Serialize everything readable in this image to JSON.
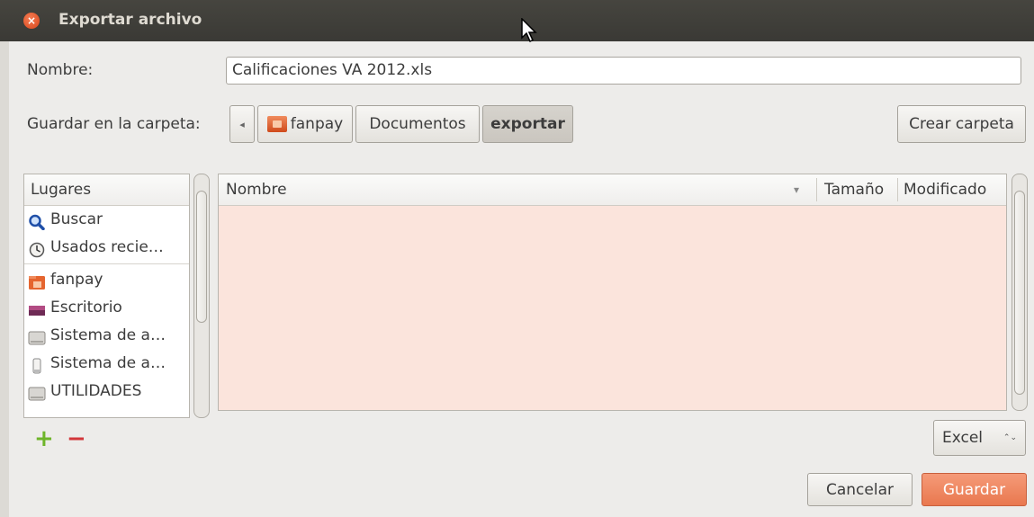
{
  "window": {
    "title": "Exportar archivo",
    "close_glyph": "×"
  },
  "name_field": {
    "label": "Nombre:",
    "value": "Calificaciones VA 2012.xls"
  },
  "folder": {
    "label": "Guardar en la carpeta:",
    "back_glyph": "◂",
    "crumbs": [
      "fanpay",
      "Documentos",
      "exportar"
    ],
    "create_folder": "Crear carpeta"
  },
  "places": {
    "header": "Lugares",
    "items": [
      {
        "label": "Buscar",
        "icon": "search-icon"
      },
      {
        "label": "Usados recie…",
        "icon": "recent-icon"
      },
      {
        "label": "fanpay",
        "icon": "home-folder-icon"
      },
      {
        "label": "Escritorio",
        "icon": "desktop-icon"
      },
      {
        "label": "Sistema de a…",
        "icon": "drive-icon"
      },
      {
        "label": "Sistema de a…",
        "icon": "usb-drive-icon"
      },
      {
        "label": "UTILIDADES",
        "icon": "drive-icon"
      }
    ],
    "add_glyph": "+",
    "remove_glyph": "−"
  },
  "files": {
    "columns": {
      "name": "Nombre",
      "size": "Tamaño",
      "modified": "Modificado"
    },
    "sort_glyph": "▾",
    "rows": []
  },
  "filter": {
    "selected": "Excel",
    "glyph": "⌃⌄"
  },
  "actions": {
    "cancel": "Cancelar",
    "save": "Guardar"
  },
  "colors": {
    "accent": "#e9784f",
    "file_area_bg": "#fbe4dc",
    "titlebar": "#3e3d39"
  }
}
